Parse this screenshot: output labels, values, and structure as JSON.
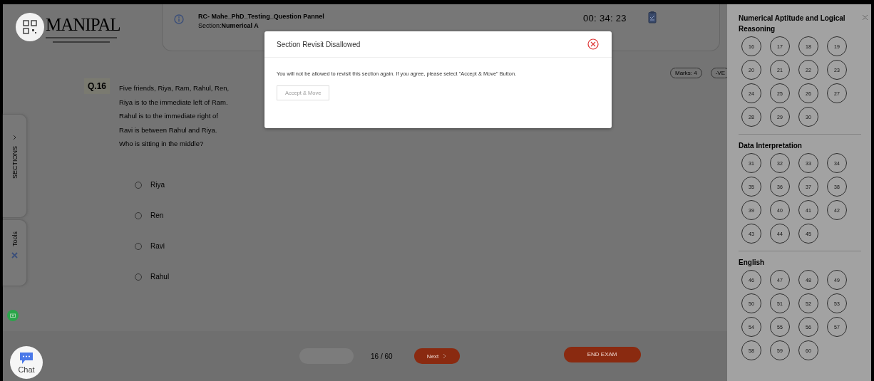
{
  "logo": {
    "text": "MANIPAL"
  },
  "header": {
    "title": "RC- Mahe_PhD_Testing_Question Pannel",
    "section": "Section:**Numerical A**",
    "timer": "00: 34: 23"
  },
  "side_tabs": [
    {
      "label": "SECTIONS",
      "kind": "arrow"
    },
    {
      "label": "Tools",
      "kind": "tools"
    }
  ],
  "question": {
    "number": "Q.16",
    "marks": "Marks: 4",
    "negative": "-VE",
    "lines": [
      "Five friends, Riya, Ram, Rahul, Ren,",
      "Riya is to the immediate left of Ram.",
      "Rahul is to the immediate right of",
      "Ravi is between Rahul and Riya.",
      "Who is sitting in the middle?"
    ],
    "options": [
      {
        "label": "Riya",
        "selected": false
      },
      {
        "label": "Ren",
        "selected": false
      },
      {
        "label": "Ravi",
        "selected": false
      },
      {
        "label": "Rahul",
        "selected": false
      }
    ]
  },
  "footer": {
    "previous": {
      "disabled": true
    },
    "progress": "16 / 60",
    "next": "Next",
    "end": "END EXAM"
  },
  "chat": {
    "label": "Chat"
  },
  "palette": {
    "sections": [
      {
        "title": "Numerical Aptitude and Logical Reasoning",
        "questions": [
          "16",
          "17",
          "18",
          "19",
          "20",
          "21",
          "22",
          "23",
          "24",
          "25",
          "26",
          "27",
          "28",
          "29",
          "30"
        ]
      },
      {
        "title": "Data Interpretation",
        "questions": [
          "31",
          "32",
          "33",
          "34",
          "35",
          "36",
          "37",
          "38",
          "39",
          "40",
          "41",
          "42",
          "43",
          "44",
          "45"
        ]
      },
      {
        "title": "English",
        "questions": [
          "46",
          "47",
          "48",
          "49",
          "50",
          "51",
          "52",
          "53",
          "54",
          "55",
          "56",
          "57",
          "58",
          "59",
          "60"
        ]
      }
    ]
  },
  "modal": {
    "title": "Section Revisit Disallowed",
    "message": "You will not be allowed to revisit this section again. If you agree, please select \"Accept & Move\" Button.",
    "button": "Accept & Move"
  }
}
